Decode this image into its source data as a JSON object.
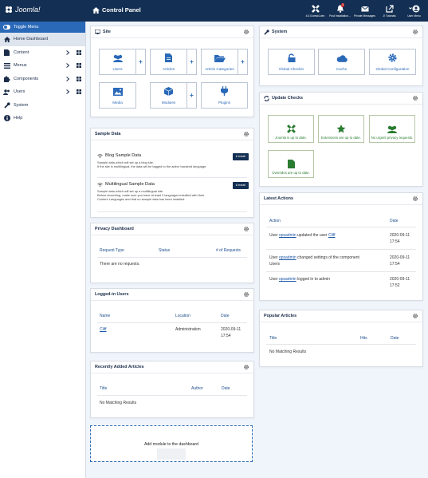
{
  "topbar": {
    "brand": "Joomla!",
    "page_title": "Control Panel",
    "icons": [
      {
        "name": "joomla-version-icon",
        "label": "4.0.0-beta4-dev"
      },
      {
        "name": "bell-icon",
        "label": "Post Installation...",
        "badge": "3"
      },
      {
        "name": "envelope-icon",
        "label": "Private Messages"
      },
      {
        "name": "external-link-icon",
        "label": "J! Tutorials"
      },
      {
        "name": "user-circle-icon",
        "label": "User Menu"
      }
    ]
  },
  "sidebar": {
    "items": [
      {
        "label": "Toggle Menu"
      },
      {
        "label": "Home Dashboard"
      },
      {
        "label": "Content"
      },
      {
        "label": "Menus"
      },
      {
        "label": "Components"
      },
      {
        "label": "Users"
      },
      {
        "label": "System"
      },
      {
        "label": "Help"
      }
    ]
  },
  "site": {
    "title": "Site",
    "icons": [
      "Users",
      "Articles",
      "Article Categories",
      "Media",
      "Modules",
      "Plugins"
    ],
    "plus": "+"
  },
  "system": {
    "title": "System",
    "icons": [
      "Global Checkin",
      "Cache",
      "Global Configuration"
    ]
  },
  "update_checks": {
    "title": "Update Checks",
    "icons": [
      "Joomla is up to date.",
      "Extensions are up to date.",
      "No urgent privacy requests.",
      "Overrides are up to date."
    ]
  },
  "sample_data": {
    "title": "Sample Data",
    "items": [
      {
        "title": "Blog Sample Data",
        "desc1": "Sample data which will set up a blog site.",
        "desc2": "If the site is multilingual, the data will be tagged to the active backend language.",
        "button": "Install"
      },
      {
        "title": "Multilingual Sample Data",
        "desc1": "Sample data which will set up a multilingual site.",
        "desc2": "Before launching, make sure you have at least 2 languages installed with their",
        "desc3": "Content Languages and that no sample data has been installed.",
        "button": "Install"
      }
    ]
  },
  "privacy": {
    "title": "Privacy Dashboard",
    "headers": [
      "Request Type",
      "Status",
      "# of Requests"
    ],
    "empty": "There are no requests."
  },
  "logged_in": {
    "title": "Logged-in Users",
    "headers": [
      "Name",
      "Location",
      "Date"
    ],
    "row": {
      "name": "Cliff",
      "location": "Administration",
      "date1": "2020-09-11",
      "date2": "17:54"
    }
  },
  "recent_articles": {
    "title": "Recently Added Articles",
    "headers": [
      "Title",
      "Author",
      "Date"
    ],
    "empty": "No Matching Results"
  },
  "add_module": "Add module to the dashboard",
  "latest_actions": {
    "title": "Latest Actions",
    "headers": [
      "Action",
      "Date"
    ],
    "rows": [
      {
        "pre": "User ",
        "user": "opsadmin",
        "mid": " updated the user ",
        "target": "Cliff",
        "extra": "",
        "date1": "2020-09-11",
        "date2": "17:54"
      },
      {
        "pre": "User ",
        "user": "opsadmin",
        "mid": " changed settings of the component",
        "target": "",
        "extra": "Users",
        "date1": "2020-09-11",
        "date2": "17:54"
      },
      {
        "pre": "User ",
        "user": "opsadmin",
        "mid": " logged in to admin",
        "target": "",
        "extra": "",
        "date1": "2020-09-11",
        "date2": "17:52"
      }
    ]
  },
  "popular_articles": {
    "title": "Popular Articles",
    "headers": [
      "Title",
      "Hits",
      "Date"
    ],
    "empty": "No Matching Results"
  },
  "colors": {
    "topbar": "#132f53",
    "accent": "#2a69b8",
    "success": "#2a7c31"
  }
}
